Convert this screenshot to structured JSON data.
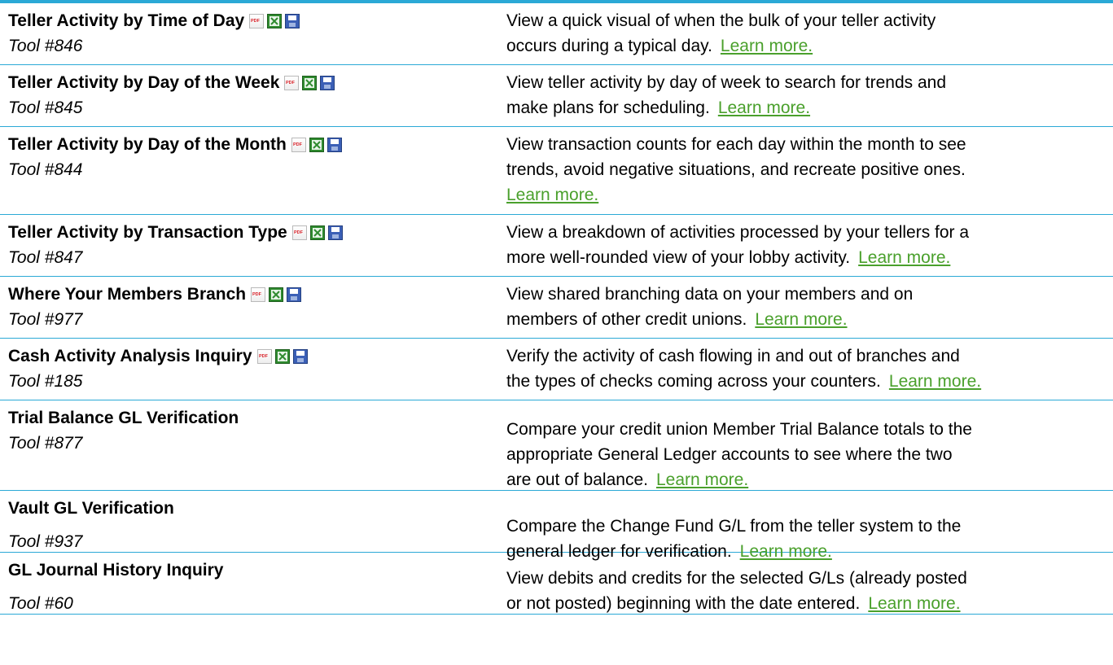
{
  "colors": {
    "rule": "#2ba9d6",
    "link": "#4aa02c"
  },
  "icons": {
    "pdf_label": "PDF",
    "names": [
      "pdf-icon",
      "excel-icon",
      "save-icon"
    ]
  },
  "tools": [
    {
      "title": "Teller Activity by Time of Day",
      "number": "Tool #846",
      "has_icons": true,
      "lines": [
        "View a quick visual of when the bulk of your teller activity",
        "occurs during a typical day."
      ],
      "link": "Learn more.",
      "link_on_own_line": false
    },
    {
      "title": "Teller Activity by Day of the Week",
      "number": "Tool #845",
      "has_icons": true,
      "lines": [
        "View teller activity by day of week to search for trends and",
        "make plans for scheduling."
      ],
      "link": "Learn more.",
      "link_on_own_line": false
    },
    {
      "title": "Teller Activity by Day of the Month",
      "number": "Tool #844",
      "has_icons": true,
      "lines": [
        "View transaction counts for each day within the month to see",
        "trends, avoid negative situations, and recreate positive ones."
      ],
      "link": "Learn more.",
      "link_on_own_line": true
    },
    {
      "title": "Teller Activity by Transaction Type",
      "number": "Tool #847",
      "has_icons": true,
      "lines": [
        "View a breakdown of activities processed by your tellers for a",
        "more well-rounded view of your lobby activity."
      ],
      "link": "Learn more.",
      "link_on_own_line": false
    },
    {
      "title": "Where Your Members Branch",
      "number": "Tool #977",
      "has_icons": true,
      "lines": [
        "View shared branching data on your members and on",
        "members of other credit unions."
      ],
      "link": "Learn more.",
      "link_on_own_line": false
    },
    {
      "title": "Cash Activity Analysis Inquiry",
      "number": "Tool #185",
      "has_icons": true,
      "lines": [
        "Verify the activity of cash flowing in and out of branches and",
        "the types of checks coming across your counters."
      ],
      "link": "Learn more.",
      "link_on_own_line": false
    },
    {
      "title": "Trial Balance GL Verification",
      "number": "Tool #877",
      "has_icons": false,
      "lines": [
        "Compare your credit union Member Trial Balance totals to the",
        "appropriate General Ledger accounts to see where the two",
        "are out of balance."
      ],
      "link": "Learn more.",
      "link_on_own_line": false
    },
    {
      "title": "Vault GL Verification",
      "number": "Tool #937",
      "has_icons": false,
      "lines": [
        "Compare the Change Fund G/L from the teller system to the",
        "general ledger for verification."
      ],
      "link": "Learn more.",
      "link_on_own_line": false
    },
    {
      "title": "GL Journal History Inquiry",
      "number": "Tool #60",
      "has_icons": false,
      "lines": [
        "View debits and credits for the selected G/Ls (already posted",
        "or not posted) beginning with the date entered."
      ],
      "link": "Learn more.",
      "link_on_own_line": false
    }
  ]
}
